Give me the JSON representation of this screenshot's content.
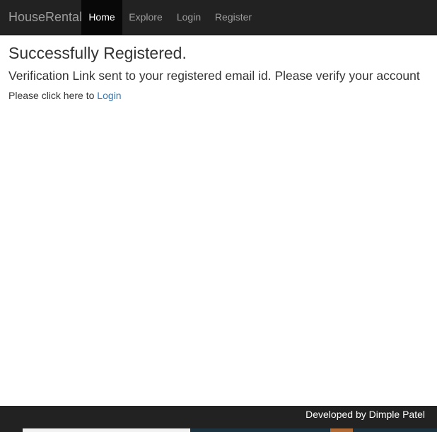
{
  "navbar": {
    "brand": "HouseRental",
    "items": [
      {
        "label": "Home",
        "active": true
      },
      {
        "label": "Explore",
        "active": false
      },
      {
        "label": "Login",
        "active": false
      },
      {
        "label": "Register",
        "active": false
      }
    ]
  },
  "main": {
    "title": "Successfully Registered.",
    "message": "Verification Link sent to your registered email id. Please verify your account",
    "login_prompt": "Please click here to",
    "login_link": "Login"
  },
  "footer": {
    "credit": "Developed by Dimple Patel"
  },
  "colors": {
    "navbar_bg": "#222222",
    "active_tab_bg": "#080808",
    "link": "#337ab7"
  }
}
